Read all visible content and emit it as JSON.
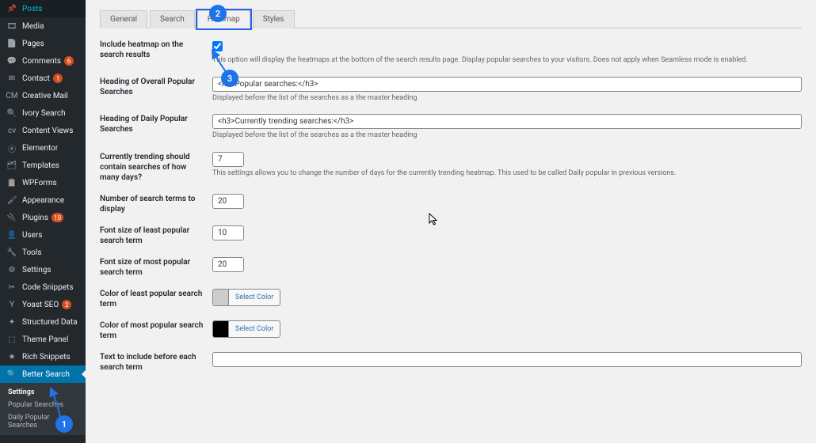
{
  "sidebar": {
    "items": [
      {
        "label": "Posts",
        "icon": "📌",
        "badge": null
      },
      {
        "label": "Media",
        "icon": "🎞",
        "badge": null
      },
      {
        "label": "Pages",
        "icon": "📄",
        "badge": null
      },
      {
        "label": "Comments",
        "icon": "💬",
        "badge": "6"
      },
      {
        "label": "Contact",
        "icon": "✉",
        "badge": "1"
      },
      {
        "label": "Creative Mail",
        "icon": "CM",
        "badge": null
      },
      {
        "label": "Ivory Search",
        "icon": "🔍",
        "badge": null
      },
      {
        "label": "Content Views",
        "icon": "cv",
        "badge": null
      },
      {
        "label": "Elementor",
        "icon": "ⓔ",
        "badge": null
      },
      {
        "label": "Templates",
        "icon": "🗂",
        "badge": null
      },
      {
        "label": "WPForms",
        "icon": "📋",
        "badge": null
      },
      {
        "label": "Appearance",
        "icon": "🖌",
        "badge": null
      },
      {
        "label": "Plugins",
        "icon": "🔌",
        "badge": "10"
      },
      {
        "label": "Users",
        "icon": "👤",
        "badge": null
      },
      {
        "label": "Tools",
        "icon": "🔧",
        "badge": null
      },
      {
        "label": "Settings",
        "icon": "⚙",
        "badge": null
      },
      {
        "label": "Code Snippets",
        "icon": "✂",
        "badge": null
      },
      {
        "label": "Yoast SEO",
        "icon": "Y",
        "badge": "2"
      },
      {
        "label": "Structured Data",
        "icon": "✦",
        "badge": null
      },
      {
        "label": "Theme Panel",
        "icon": "⬚",
        "badge": null
      },
      {
        "label": "Rich Snippets",
        "icon": "★",
        "badge": null
      },
      {
        "label": "Better Search",
        "icon": "🔍",
        "badge": null
      }
    ],
    "sub": {
      "title": "Settings",
      "items": [
        "Popular Searches",
        "Daily Popular Searches"
      ]
    }
  },
  "tabs": [
    "General",
    "Search",
    "Heatmap",
    "Styles"
  ],
  "fields": {
    "include": {
      "label": "Include heatmap on the search results",
      "desc": "This option will display the heatmaps at the bottom of the search results page. Display popular searches to your visitors. Does not apply when Seamless mode is enabled."
    },
    "heading_overall": {
      "label": "Heading of Overall Popular Searches",
      "value": "<h3>Popular searches:</h3>",
      "desc": "Displayed before the list of the searches as a the master heading"
    },
    "heading_daily": {
      "label": "Heading of Daily Popular Searches",
      "value": "<h3>Currently trending searches:</h3>",
      "desc": "Displayed before the list of the searches as a the master heading"
    },
    "trending_days": {
      "label": "Currently trending should contain searches of how many days?",
      "value": "7",
      "desc": "This settings allows you to change the number of days for the currently trending heatmap. This used to be called Daily popular in previous versions."
    },
    "num_terms": {
      "label": "Number of search terms to display",
      "value": "20"
    },
    "font_least": {
      "label": "Font size of least popular search term",
      "value": "10"
    },
    "font_most": {
      "label": "Font size of most popular search term",
      "value": "20"
    },
    "color_least": {
      "label": "Color of least popular search term",
      "btn": "Select Color",
      "swatch": "#cccccc"
    },
    "color_most": {
      "label": "Color of most popular search term",
      "btn": "Select Color",
      "swatch": "#000000"
    },
    "text_before": {
      "label": "Text to include before each search term",
      "value": ""
    }
  },
  "anno": {
    "1": "1",
    "2": "2",
    "3": "3"
  }
}
